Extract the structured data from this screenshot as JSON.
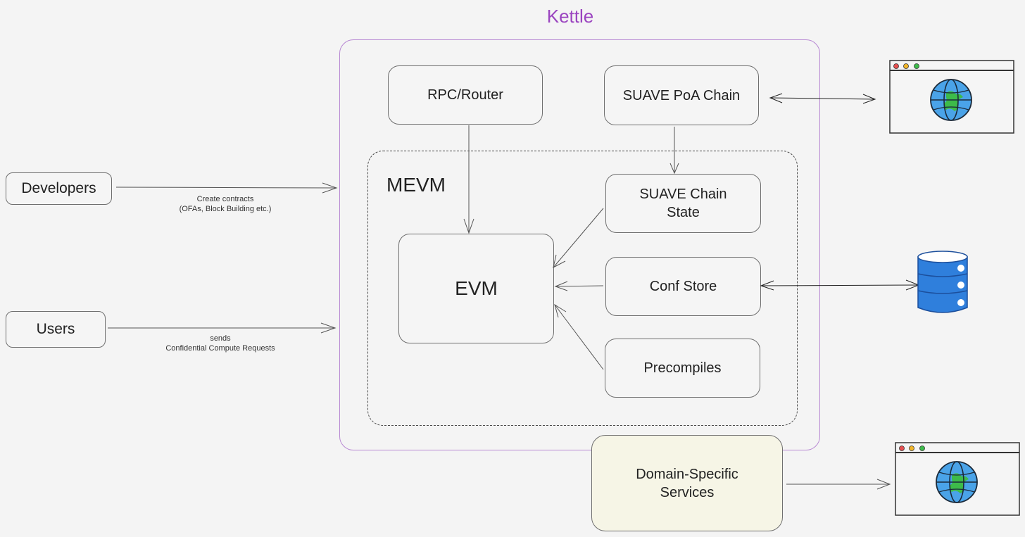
{
  "title": "Kettle",
  "group_label": "MEVM",
  "nodes": {
    "developers": "Developers",
    "users": "Users",
    "rpc_router": "RPC/Router",
    "suave_poa_chain": "SUAVE PoA Chain",
    "suave_chain_state": "SUAVE Chain\nState",
    "evm": "EVM",
    "conf_store": "Conf Store",
    "precompiles": "Precompiles",
    "domain_specific_services": "Domain-Specific\nServices"
  },
  "edges": {
    "developers_to_kettle": {
      "line1": "Create contracts",
      "line2": "(OFAs, Block Building etc.)"
    },
    "users_to_kettle": {
      "line1": "sends",
      "line2": "Confidential Compute Requests"
    }
  },
  "icons": {
    "web_browser_top": "browser-globe-icon",
    "database": "database-icon",
    "web_browser_bottom": "browser-globe-icon"
  },
  "colors": {
    "kettle_accent": "#9b45c0",
    "kettle_border": "#b889d3",
    "domain_fill": "#f6f5e6",
    "globe_blue": "#4aa3e8",
    "globe_green": "#3dbb4a",
    "db_blue": "#2f7fdc"
  }
}
